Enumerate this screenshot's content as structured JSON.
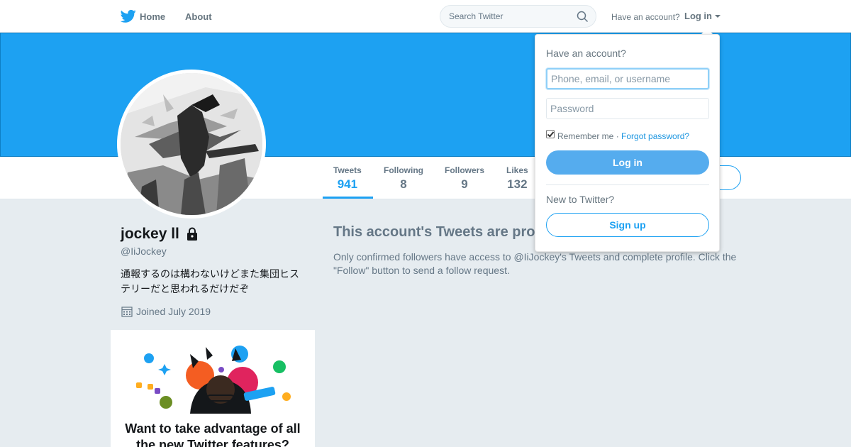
{
  "header": {
    "home_label": "Home",
    "about_label": "About",
    "search_placeholder": "Search Twitter",
    "have_account": "Have an account?",
    "login_label": "Log in",
    "brand_color": "#1da1f2"
  },
  "profile": {
    "name": "jockey ll",
    "handle": "@IiJockey",
    "bio": "通報するのは構わないけどまた集団ヒステリーだと思われるだけだぞ",
    "joined": "Joined July 2019",
    "stats": [
      {
        "label": "Tweets",
        "value": "941"
      },
      {
        "label": "Following",
        "value": "8"
      },
      {
        "label": "Followers",
        "value": "9"
      },
      {
        "label": "Likes",
        "value": "132"
      }
    ]
  },
  "protected": {
    "title": "This account's Tweets are protected.",
    "text": "Only confirmed followers have access to @IiJockey's Tweets and complete profile. Click the \"Follow\" button to send a follow request."
  },
  "promo": {
    "title": "Want to take advantage of all the new Twitter features?"
  },
  "login_dropdown": {
    "heading": "Have an account?",
    "username_placeholder": "Phone, email, or username",
    "password_placeholder": "Password",
    "remember_label": "Remember me",
    "separator": " · ",
    "forgot_label": "Forgot password?",
    "login_button": "Log in",
    "new_label": "New to Twitter?",
    "signup_button": "Sign up"
  }
}
